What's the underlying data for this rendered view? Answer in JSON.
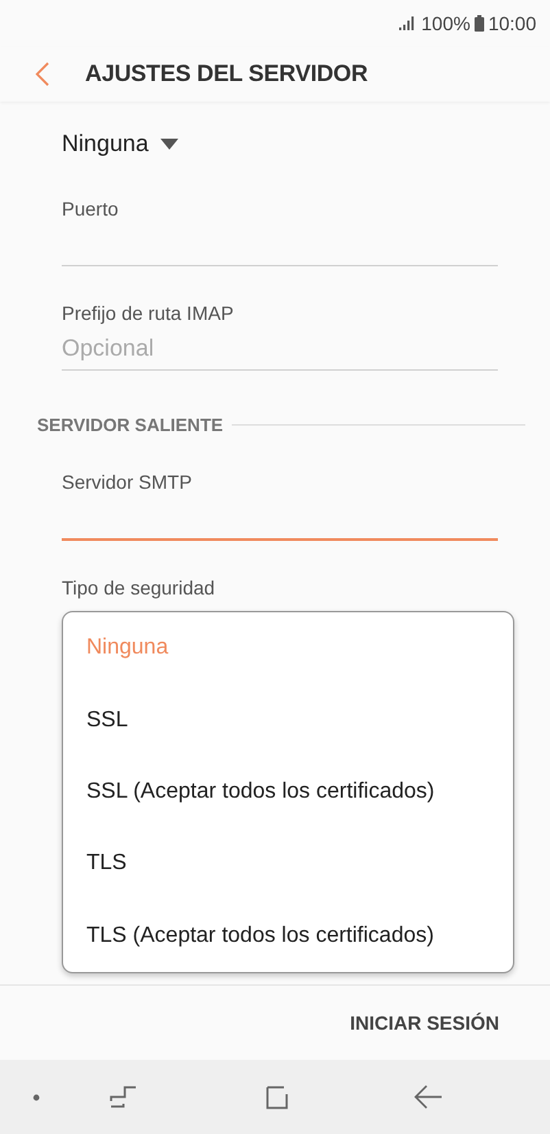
{
  "status_bar": {
    "battery": "100%",
    "time": "10:00"
  },
  "header": {
    "title": "AJUSTES DEL SERVIDOR"
  },
  "incoming": {
    "security_value": "Ninguna",
    "fields": [
      {
        "label": "Puerto",
        "focused": false
      },
      {
        "label": "Prefijo de ruta IMAP",
        "placeholder": "Opcional",
        "focused": false
      }
    ]
  },
  "outgoing": {
    "heading": "SERVIDOR SALIENTE",
    "fields": [
      {
        "label": "Servidor SMTP",
        "focused": true
      }
    ],
    "security_label": "Tipo de seguridad"
  },
  "dropdown": {
    "options": [
      {
        "label": "Ninguna",
        "selected": true
      },
      {
        "label": "SSL",
        "selected": false
      },
      {
        "label": "SSL (Aceptar todos los certificados)",
        "selected": false
      },
      {
        "label": "TLS",
        "selected": false
      },
      {
        "label": "TLS (Aceptar todos los certificados)",
        "selected": false
      }
    ]
  },
  "footer": {
    "button": "INICIAR SESIÓN"
  }
}
